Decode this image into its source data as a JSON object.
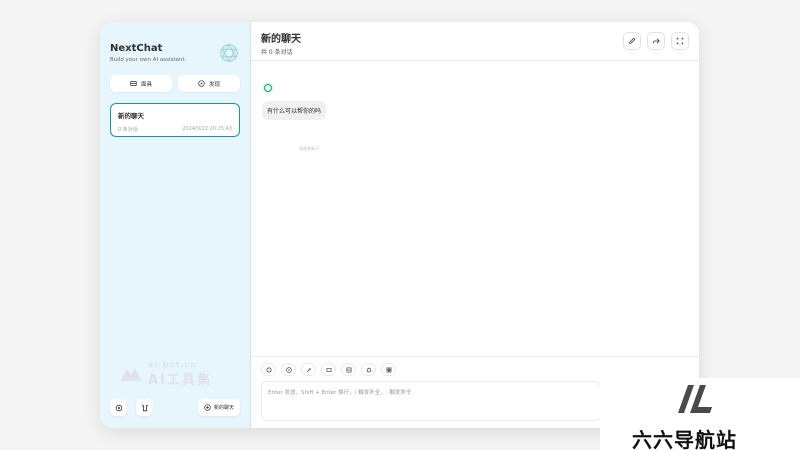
{
  "sidebar": {
    "title": "NextChat",
    "subtitle": "Build your own AI assistant.",
    "buttons": [
      {
        "label": "面具",
        "icon": "mask-icon"
      },
      {
        "label": "发现",
        "icon": "discover-icon"
      }
    ],
    "chat_item": {
      "title": "新的聊天",
      "count": "0 条对话",
      "time": "2024/9/22 20:15:43"
    },
    "watermark": {
      "line1": "ai-bot.cn",
      "line2": "AI工具集"
    },
    "new_chat_label": "新的聊天"
  },
  "header": {
    "title": "新的聊天",
    "subtitle": "共 0 条对话"
  },
  "message": {
    "text": "有什么可以帮你的吗",
    "time": "刚刚更新于"
  },
  "input": {
    "placeholder": "Enter 发送，Shift + Enter 换行，/ 触发补全，: 触发命令"
  },
  "site_logo": {
    "name": "六六导航站"
  },
  "colors": {
    "sidebar_bg": "#e7f6fd",
    "accent": "#1d93ab"
  }
}
